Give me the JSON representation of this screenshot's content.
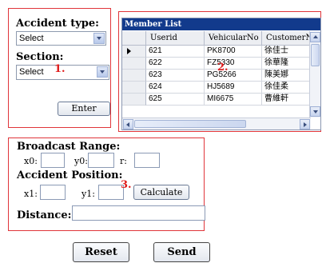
{
  "accident": {
    "type_label": "Accident type:",
    "type_select": "Select",
    "section_label": "Section:",
    "section_select": "Select",
    "marker": "1.",
    "enter_button": "Enter"
  },
  "member_list": {
    "title": "Member List",
    "columns": [
      "Userid",
      "VehicularNo",
      "CustomerN"
    ],
    "rows": [
      {
        "userid": "621",
        "vehicular": "PK8700",
        "customer": "徐佳士"
      },
      {
        "userid": "622",
        "vehicular": "FZ5330",
        "customer": "徐華隆"
      },
      {
        "userid": "623",
        "vehicular": "PG5266",
        "customer": "陳美娜"
      },
      {
        "userid": "624",
        "vehicular": "HJ5689",
        "customer": "徐佳柔"
      },
      {
        "userid": "625",
        "vehicular": "MI6675",
        "customer": "曹維軒"
      }
    ],
    "marker": "2."
  },
  "broadcast": {
    "range_label": "Broadcast Range:",
    "x0_label": "x0:",
    "y0_label": "y0:",
    "r_label": "r:",
    "position_label": "Accident Position:",
    "x1_label": "x1:",
    "y1_label": "y1:",
    "marker": "3.",
    "calculate_button": "Calculate",
    "distance_label": "Distance:"
  },
  "actions": {
    "reset_button": "Reset",
    "send_button": "Send"
  },
  "colors": {
    "panel_border": "#e0353a",
    "marker": "#e01b1b",
    "grid_title_bg": "#123a8c"
  }
}
